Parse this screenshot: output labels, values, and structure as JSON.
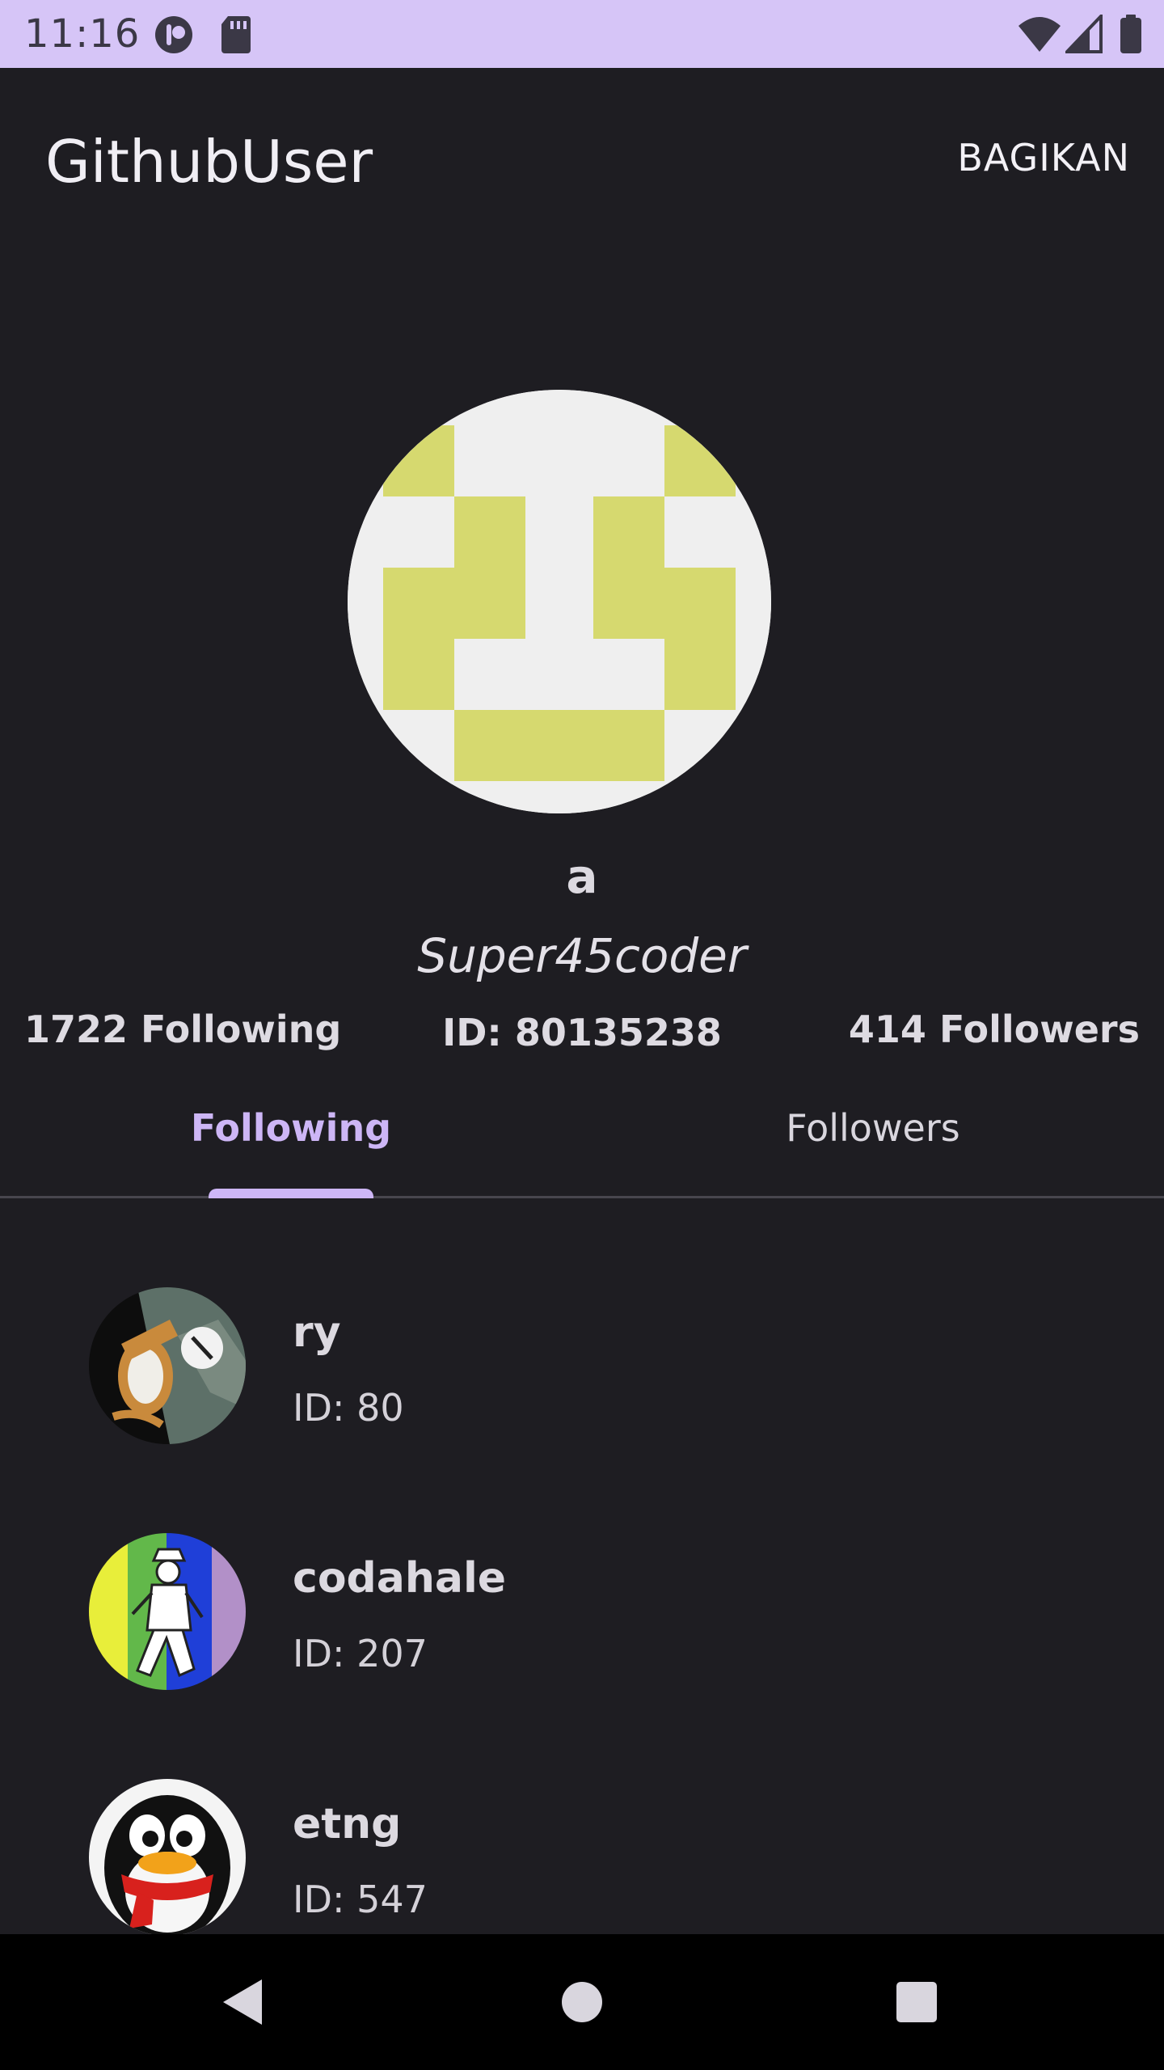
{
  "status_bar": {
    "time": "11:16"
  },
  "app_bar": {
    "title": "GithubUser",
    "share_label": "BAGIKAN"
  },
  "profile": {
    "name": "a",
    "login": "Super45coder",
    "following": "1722 Following",
    "id": "ID: 80135238",
    "followers": "414 Followers"
  },
  "tabs": [
    {
      "label": "Following",
      "selected": true
    },
    {
      "label": "Followers",
      "selected": false
    }
  ],
  "users": [
    {
      "name": "ry",
      "id": "ID: 80"
    },
    {
      "name": "codahale",
      "id": "ID: 207"
    },
    {
      "name": "etng",
      "id": "ID: 547"
    }
  ],
  "colors": {
    "status_bar": "#d6c5f7",
    "accent": "#cdb6f6",
    "background": "#1e1d22",
    "identicon": "#d6d96f"
  }
}
